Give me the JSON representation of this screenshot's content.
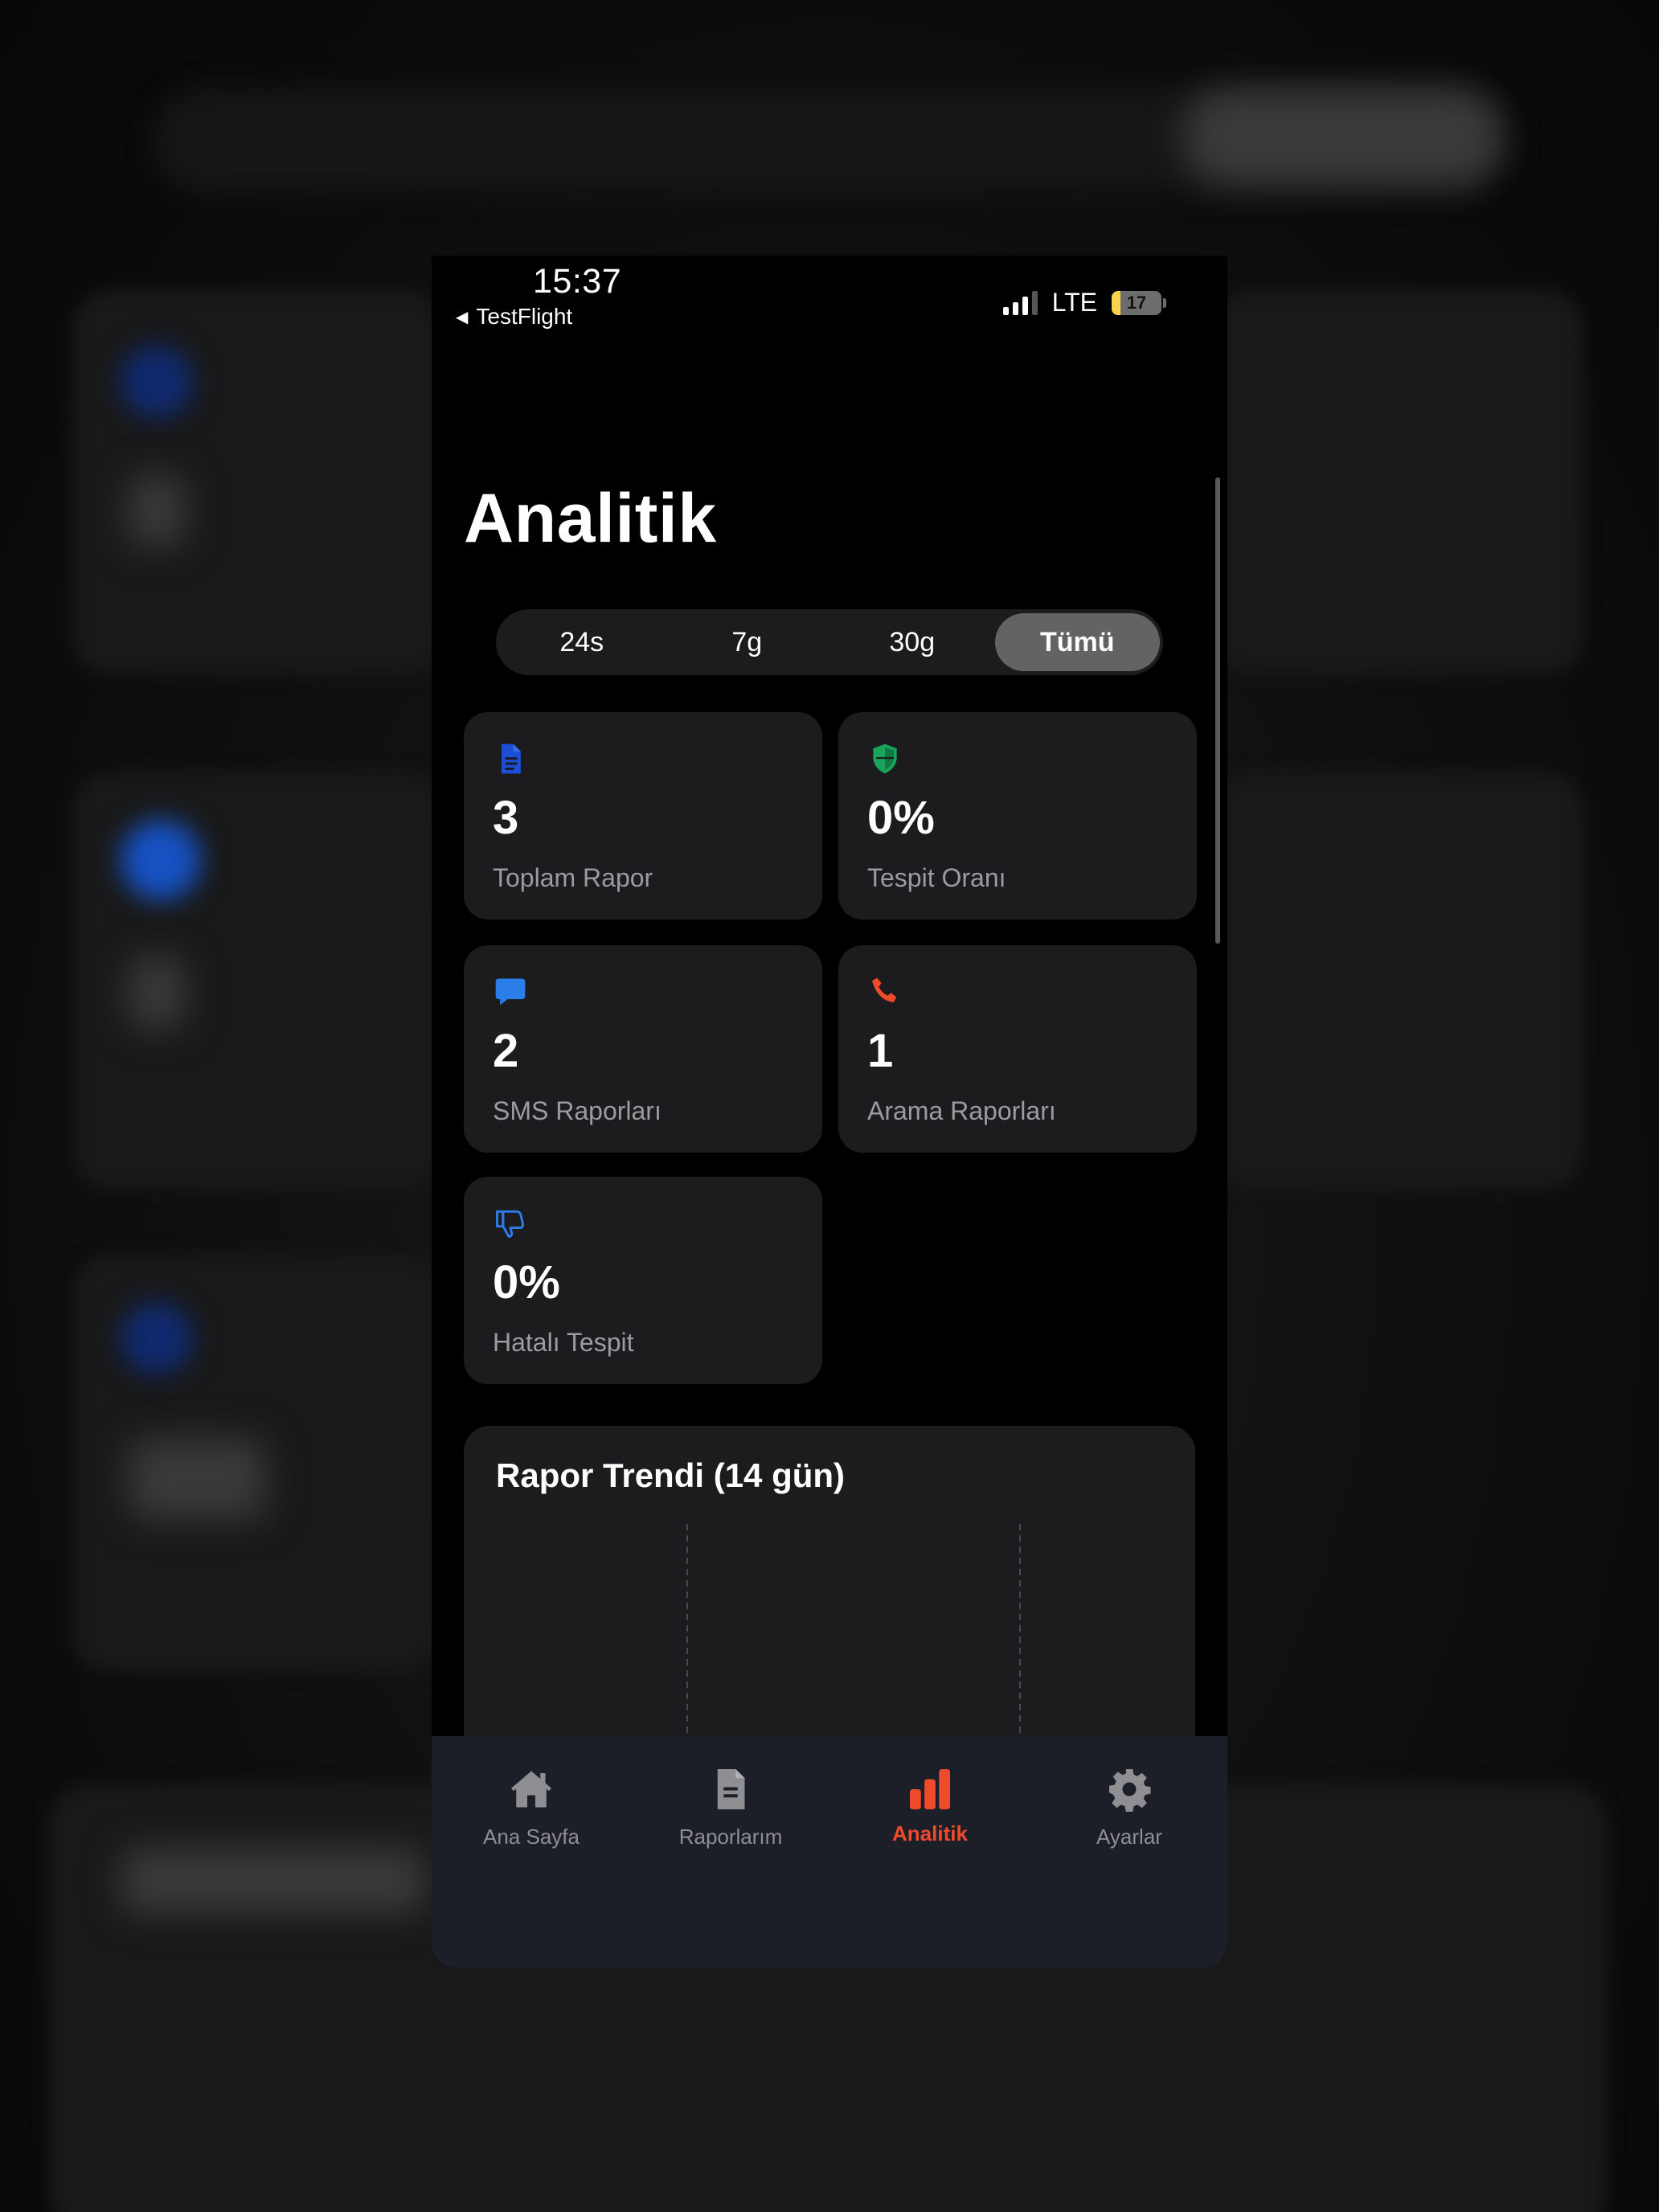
{
  "status_bar": {
    "time": "15:37",
    "back_app": "TestFlight",
    "network": "LTE",
    "battery_level": "17"
  },
  "page_title": "Analitik",
  "period_tabs": [
    {
      "label": "24s",
      "selected": false
    },
    {
      "label": "7g",
      "selected": false
    },
    {
      "label": "30g",
      "selected": false
    },
    {
      "label": "Tümü",
      "selected": true
    }
  ],
  "stats": [
    {
      "icon": "document-icon",
      "color": "#1d4ed8",
      "value": "3",
      "label": "Toplam Rapor"
    },
    {
      "icon": "shield-icon",
      "color": "#18a45a",
      "value": "0%",
      "label": "Tespit Oranı"
    },
    {
      "icon": "message-icon",
      "color": "#2b7de9",
      "value": "2",
      "label": "SMS Raporları"
    },
    {
      "icon": "phone-icon",
      "color": "#f04a2c",
      "value": "1",
      "label": "Arama Raporları"
    },
    {
      "icon": "thumbs-down-icon",
      "color": "#2b7de9",
      "value": "0%",
      "label": "Hatalı Tespit"
    }
  ],
  "trend_card": {
    "title": "Rapor Trendi (14 gün)"
  },
  "tab_bar": [
    {
      "icon": "home-icon",
      "label": "Ana Sayfa",
      "active": false
    },
    {
      "icon": "document-icon",
      "label": "Raporlarım",
      "active": false
    },
    {
      "icon": "bar-chart-icon",
      "label": "Analitik",
      "active": true
    },
    {
      "icon": "gear-icon",
      "label": "Ayarlar",
      "active": false
    }
  ],
  "colors": {
    "accent": "#f04a2c",
    "card_bg": "#1c1c1e",
    "tabbar_bg": "#1c1f27"
  }
}
